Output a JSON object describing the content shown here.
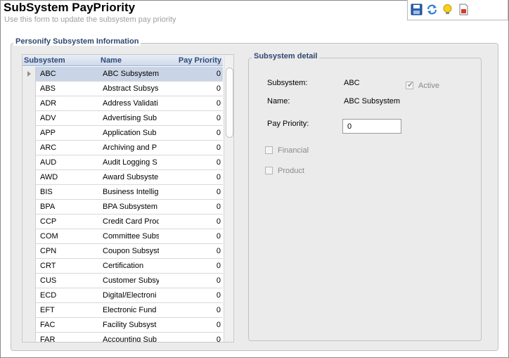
{
  "header": {
    "title": "SubSystem PayPriority",
    "subtitle": "Use this form to update the subsystem pay priority"
  },
  "toolbar": {
    "buttons": [
      {
        "name": "save",
        "icon": "save-icon"
      },
      {
        "name": "refresh",
        "icon": "refresh-icon"
      },
      {
        "name": "help",
        "icon": "lightbulb-icon"
      },
      {
        "name": "report",
        "icon": "document-icon"
      }
    ]
  },
  "main_group": {
    "legend": "Personify Subsystem Information"
  },
  "grid": {
    "columns": [
      "Subsystem",
      "Name",
      "Pay Priority"
    ],
    "rows": [
      {
        "code": "ABC",
        "name": "ABC Subsystem",
        "priority": "0"
      },
      {
        "code": "ABS",
        "name": "Abstract Subsys",
        "priority": "0"
      },
      {
        "code": "ADR",
        "name": "Address Validati",
        "priority": "0"
      },
      {
        "code": "ADV",
        "name": "Advertising Sub",
        "priority": "0"
      },
      {
        "code": "APP",
        "name": "Application Sub",
        "priority": "0"
      },
      {
        "code": "ARC",
        "name": "Archiving and P",
        "priority": "0"
      },
      {
        "code": "AUD",
        "name": "Audit Logging S",
        "priority": "0"
      },
      {
        "code": "AWD",
        "name": "Award Subsyste",
        "priority": "0"
      },
      {
        "code": "BIS",
        "name": "Business Intellig",
        "priority": "0"
      },
      {
        "code": "BPA",
        "name": "BPA Subsystem",
        "priority": "0"
      },
      {
        "code": "CCP",
        "name": "Credit Card Proc",
        "priority": "0"
      },
      {
        "code": "COM",
        "name": "Committee Subs",
        "priority": "0"
      },
      {
        "code": "CPN",
        "name": "Coupon Subsyst",
        "priority": "0"
      },
      {
        "code": "CRT",
        "name": "Certification",
        "priority": "0"
      },
      {
        "code": "CUS",
        "name": "Customer Subsy",
        "priority": "0"
      },
      {
        "code": "ECD",
        "name": "Digital/Electroni",
        "priority": "0"
      },
      {
        "code": "EFT",
        "name": "Electronic Fund",
        "priority": "0"
      },
      {
        "code": "FAC",
        "name": "Facility Subsyst",
        "priority": "0"
      },
      {
        "code": "FAR",
        "name": "Accounting Sub",
        "priority": "0"
      }
    ]
  },
  "detail": {
    "legend": "Subsystem detail",
    "subsystem_label": "Subsystem:",
    "subsystem_value": "ABC",
    "name_label": "Name:",
    "name_value": "ABC Subsystem",
    "pay_priority_label": "Pay Priority:",
    "pay_priority_value": "0",
    "active_label": "Active",
    "active_checked": true,
    "financial_label": "Financial",
    "financial_checked": false,
    "product_label": "Product",
    "product_checked": false
  }
}
